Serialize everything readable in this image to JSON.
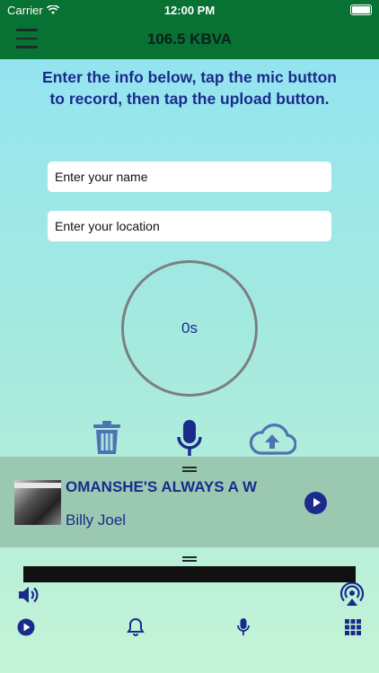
{
  "status_bar": {
    "carrier": "Carrier",
    "time": "12:00 PM"
  },
  "nav": {
    "title": "106.5 KBVA",
    "menu_icon": "hamburger-menu-icon"
  },
  "instructions": "Enter the info below, tap the mic button to record, then tap the upload button.",
  "form": {
    "name_placeholder": "Enter your name",
    "location_placeholder": "Enter your location"
  },
  "recorder": {
    "timer": "0s",
    "actions": [
      "trash-icon",
      "microphone-icon",
      "cloud-upload-icon"
    ]
  },
  "now_playing": {
    "title": "OMANSHE'S ALWAYS A W",
    "artist": "Billy Joel",
    "album_art_icon": "album-art",
    "play_icon": "play-icon"
  },
  "bottom_bar": {
    "icons": [
      "speaker-icon",
      "airplay-icon",
      "play-circle-icon",
      "bell-icon",
      "microphone-icon",
      "grid-icon"
    ]
  },
  "colors": {
    "header": "#077233",
    "accent": "#1a2b8c",
    "now_playing_bg": "#9bc8b0"
  }
}
